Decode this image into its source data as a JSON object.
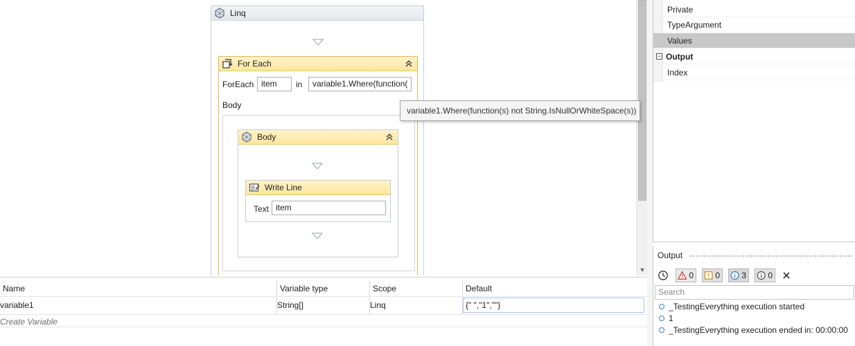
{
  "designer": {
    "sequence": {
      "title": "Linq"
    },
    "foreach": {
      "title": "For Each",
      "foreach_label": "ForEach",
      "item_value": "item",
      "in_label": "in",
      "values_expr": "variable1.Where(function(",
      "body_label": "Body"
    },
    "body_sequence": {
      "title": "Body"
    },
    "writeline": {
      "title": "Write Line",
      "text_label": "Text",
      "text_value": "item"
    },
    "tooltip": "variable1.Where(function(s) not String.IsNullOrWhiteSpace(s))"
  },
  "variables": {
    "columns": [
      "Name",
      "Variable type",
      "Scope",
      "Default"
    ],
    "rows": [
      {
        "name": "variable1",
        "type": "String[]",
        "scope": "Linq",
        "default": "{\"   \",\"1\",\"\"}"
      }
    ],
    "create_label": "Create Variable"
  },
  "properties": {
    "rows": [
      {
        "label": "Private",
        "kind": "prop"
      },
      {
        "label": "TypeArgument",
        "kind": "prop"
      },
      {
        "label": "Values",
        "kind": "prop",
        "selected": true
      },
      {
        "label": "Output",
        "kind": "category",
        "toggle": "−"
      },
      {
        "label": "Index",
        "kind": "prop"
      }
    ]
  },
  "output": {
    "title": "Output",
    "counts": {
      "errors": "0",
      "warnings": "0",
      "info": "3",
      "trace": "0"
    },
    "search_placeholder": "Search",
    "logs": [
      "_TestingEverything execution started",
      "1",
      "_TestingEverything execution ended in: 00:00:00"
    ]
  },
  "colors": {
    "foreach_header": "#fde69d",
    "foreach_border": "#e2b75a",
    "selected_row": "#c8c8c8",
    "info_blue": "#3d7bd1",
    "error_red": "#d13b3b",
    "warning_orange": "#e08a00"
  },
  "icons": {
    "sequence": "sequence-icon",
    "foreach": "foreach-icon",
    "writeline": "writeline-icon",
    "collapse": "chevron-double-up-icon",
    "drop": "drop-target-triangle-icon",
    "clock": "clock-icon",
    "error": "error-triangle-icon",
    "warning": "warning-icon",
    "info": "info-icon",
    "trace": "trace-icon",
    "clear": "clear-x-icon"
  }
}
